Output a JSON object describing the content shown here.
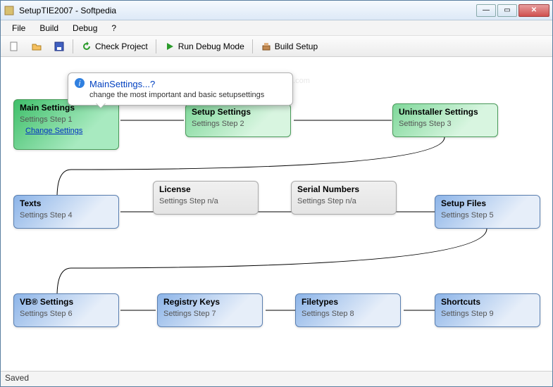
{
  "window": {
    "title": "SetupTIE2007 - Softpedia"
  },
  "menu": {
    "file": "File",
    "build": "Build",
    "debug": "Debug",
    "help": "?"
  },
  "toolbar": {
    "check": "Check Project",
    "run": "Run Debug Mode",
    "build": "Build Setup"
  },
  "watermark": "www.softpedia.com",
  "tooltip": {
    "title": "MainSettings...?",
    "body": "change the most important and basic setupsettings"
  },
  "nodes": {
    "main": {
      "title": "Main Settings",
      "sub": "Settings Step 1",
      "link": "Change Settings"
    },
    "setup": {
      "title": "Setup Settings",
      "sub": "Settings Step 2"
    },
    "uninst": {
      "title": "Uninstaller Settings",
      "sub": "Settings Step 3"
    },
    "texts": {
      "title": "Texts",
      "sub": "Settings Step 4"
    },
    "license": {
      "title": "License",
      "sub": "Settings Step n/a"
    },
    "serial": {
      "title": "Serial Numbers",
      "sub": "Settings Step n/a"
    },
    "files": {
      "title": "Setup Files",
      "sub": "Settings Step 5"
    },
    "vb": {
      "title": "VB® Settings",
      "sub": "Settings Step 6"
    },
    "registry": {
      "title": "Registry Keys",
      "sub": "Settings Step 7"
    },
    "filetypes": {
      "title": "Filetypes",
      "sub": "Settings Step 8"
    },
    "shortcuts": {
      "title": "Shortcuts",
      "sub": "Settings Step 9"
    }
  },
  "status": "Saved"
}
